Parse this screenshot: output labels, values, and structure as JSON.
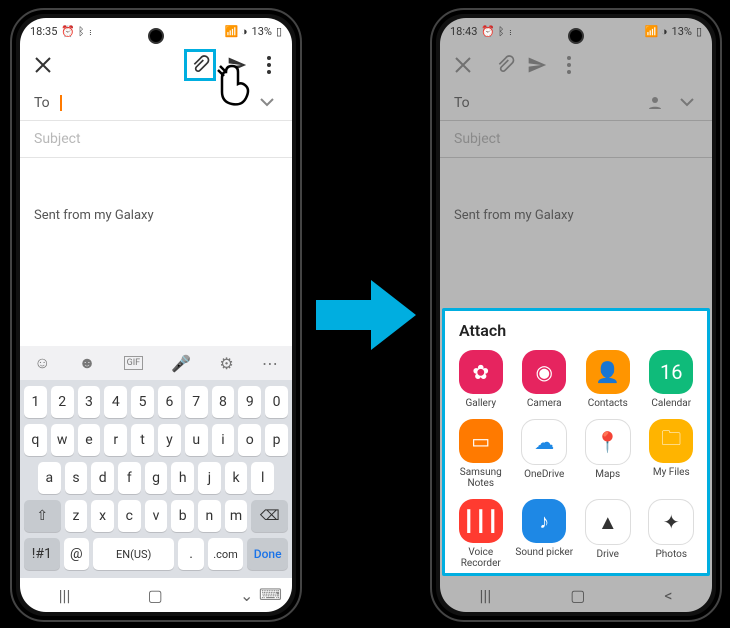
{
  "left": {
    "status": {
      "time": "18:35",
      "icons": "⏰ ᛒ ⋮",
      "right": "📶 ⚡ 13%",
      "battery_pct": "13%"
    },
    "to_label": "To",
    "subject_placeholder": "Subject",
    "body_sig": "Sent from my Galaxy",
    "kb_lang": "EN(US)",
    "kb_dotcom": ".com",
    "kb_done": "Done",
    "kb_sym": "!#1",
    "kb_at": "@",
    "kb_rows": {
      "r1": [
        "1",
        "2",
        "3",
        "4",
        "5",
        "6",
        "7",
        "8",
        "9",
        "0"
      ],
      "r2": [
        "q",
        "w",
        "e",
        "r",
        "t",
        "y",
        "u",
        "i",
        "o",
        "p"
      ],
      "r3": [
        "a",
        "s",
        "d",
        "f",
        "g",
        "h",
        "j",
        "k",
        "l"
      ],
      "r4": [
        "z",
        "x",
        "c",
        "v",
        "b",
        "n",
        "m"
      ]
    }
  },
  "right": {
    "status": {
      "time": "18:43",
      "icons": "⏰ ᛒ ⋮",
      "right": "📶 ⚡ 13%",
      "battery_pct": "13%"
    },
    "to_label": "To",
    "subject_placeholder": "Subject",
    "body_sig": "Sent from my Galaxy",
    "sheet_title": "Attach",
    "apps": [
      {
        "label": "Gallery",
        "bg": "#e6245f",
        "glyph": "✿"
      },
      {
        "label": "Camera",
        "bg": "#e6245f",
        "glyph": "◉"
      },
      {
        "label": "Contacts",
        "bg": "#ff9500",
        "glyph": "👤"
      },
      {
        "label": "Calendar",
        "bg": "#0fbb7a",
        "glyph": "16"
      },
      {
        "label": "Samsung Notes",
        "bg": "#ff7a00",
        "glyph": "▭"
      },
      {
        "label": "OneDrive",
        "bg": "#ffffff",
        "glyph": "☁",
        "fg": "#1e88e5"
      },
      {
        "label": "Maps",
        "bg": "#ffffff",
        "glyph": "📍",
        "fg": "#333"
      },
      {
        "label": "My Files",
        "bg": "#ffb400",
        "glyph": "🗀"
      },
      {
        "label": "Voice Recorder",
        "bg": "#ff3b30",
        "glyph": "┃┃┃"
      },
      {
        "label": "Sound picker",
        "bg": "#1e88e5",
        "glyph": "♪"
      },
      {
        "label": "Drive",
        "bg": "#ffffff",
        "glyph": "▲",
        "fg": "#333"
      },
      {
        "label": "Photos",
        "bg": "#ffffff",
        "glyph": "✦",
        "fg": "#333"
      }
    ]
  }
}
